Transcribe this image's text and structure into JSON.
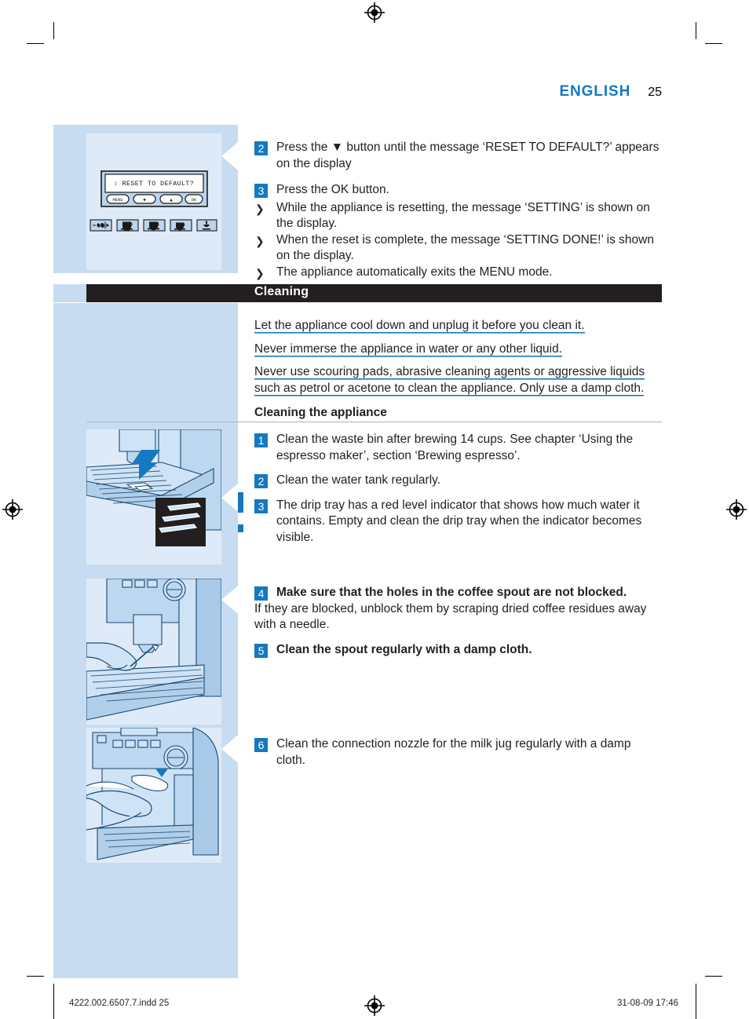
{
  "header": {
    "language": "ENGLISH",
    "page_number": "25"
  },
  "top_steps": [
    {
      "number": "2",
      "text": "Press the ▼ button until the message ‘RESET TO DEFAULT?’ appears on the display"
    },
    {
      "number": "3",
      "text": "Press the OK button."
    }
  ],
  "top_bullets": [
    {
      "glyph": "❯",
      "text": "While the appliance is resetting, the message ‘SETTING’ is shown on the display."
    },
    {
      "glyph": "❯",
      "text": "When the reset is complete, the message ‘SETTING DONE!’ is shown on the display."
    },
    {
      "glyph": "❯",
      "text": "The appliance automatically exits the MENU mode."
    }
  ],
  "chapter": {
    "title": "Cleaning"
  },
  "warnings": [
    "Let the appliance cool down and unplug it before you clean it.",
    "Never immerse the appliance in water or any other liquid.",
    "Never use scouring pads, abrasive cleaning agents or aggressive liquids such as petrol or acetone to clean the appliance. Only use a damp cloth."
  ],
  "subheading": "Cleaning the appliance",
  "clean_steps": [
    {
      "number": "1",
      "bold": false,
      "text": "Clean the waste bin after brewing 14 cups. See chapter ‘Using the espresso maker’, section ‘Brewing espresso’."
    },
    {
      "number": "2",
      "bold": false,
      "text": "Clean the water tank regularly."
    },
    {
      "number": "3",
      "bold": false,
      "text": "The drip tray has a red level indicator that shows how much water it contains. Empty and clean the drip tray when the indicator becomes visible."
    },
    {
      "number": "4",
      "bold": true,
      "text": "Make sure that the holes in the coffee spout are not blocked."
    },
    {
      "number": "5",
      "bold": true,
      "text": "Clean the spout regularly with a damp cloth."
    },
    {
      "number": "6",
      "bold": false,
      "text": "Clean the connection nozzle for the milk jug regularly with a damp cloth."
    }
  ],
  "note_after_step4": "If they are blocked, unblock them by scraping dried coffee residues away with a needle.",
  "illustrations": {
    "control_panel": {
      "display_text": "↕ RESET TO DEFAULT?",
      "buttons": [
        "MENU",
        "▼",
        "▲",
        "OK"
      ],
      "icon_names": [
        "bean-strength-icon",
        "tall-cup-icon",
        "cup-saucer-icon",
        "espresso-cup-icon",
        "hot-water-steam-icon"
      ]
    },
    "drip_tray": {
      "caption_icon": "drip-tray-level-indicator-illustration"
    },
    "coffee_spout": {
      "caption_icon": "coffee-spout-cleaning-illustration"
    },
    "milk_nozzle": {
      "caption_icon": "milk-jug-nozzle-cleaning-illustration"
    }
  },
  "footer": {
    "file": "4222.002.6507.7.indd   25",
    "timestamp": "31-08-09   17:46"
  },
  "colors": {
    "accent_blue": "#1479c0",
    "rail_blue": "#c7dcf1",
    "illustration_blue": "#dfeaf8",
    "chapter_bar": "#231f20",
    "ink": "#231f20"
  }
}
